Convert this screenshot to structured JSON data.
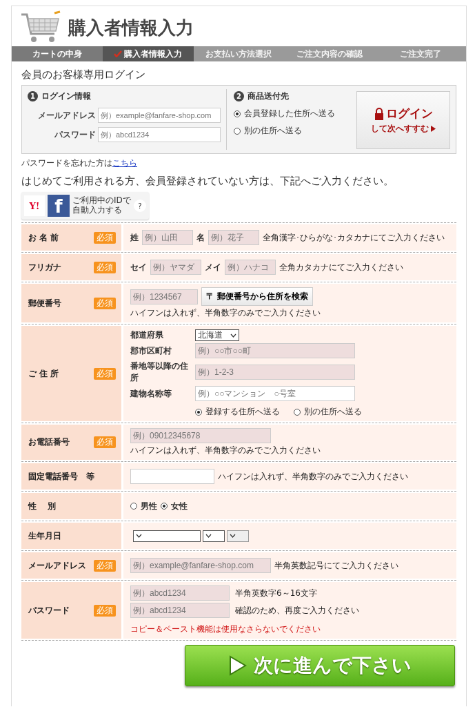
{
  "header": {
    "title": "購入者情報入力"
  },
  "steps": [
    {
      "label": "カートの中身",
      "selected": false,
      "completed": true
    },
    {
      "label": "購入者情報入力",
      "selected": true,
      "completed": false
    },
    {
      "label": "お支払い方法選択",
      "selected": false,
      "completed": false
    },
    {
      "label": "ご注文内容の確認",
      "selected": false,
      "completed": false
    },
    {
      "label": "ご注文完了",
      "selected": false,
      "completed": false
    }
  ],
  "login": {
    "heading": "会員のお客様専用ログイン",
    "info": {
      "number": "1",
      "title": "ログイン情報",
      "fields": [
        {
          "label": "メールアドレス",
          "placeholder": "例）example@fanfare-shop.com"
        },
        {
          "label": "パスワード",
          "placeholder": "例）abcd1234"
        }
      ]
    },
    "shipping": {
      "number": "2",
      "title": "商品送付先",
      "options": [
        {
          "label": "会員登録した住所へ送る",
          "selected": true
        },
        {
          "label": "別の住所へ送る",
          "selected": false
        }
      ]
    },
    "button": {
      "label": "ログイン",
      "sublabel": "して次へすすむ"
    }
  },
  "forgot": {
    "text": "パスワードを忘れた方は",
    "link": "こちら"
  },
  "guest_heading": "はじめてご利用される方、会員登録されていない方は、下記へご入力ください。",
  "social": {
    "yahoo": "Y!",
    "facebook": "f",
    "lines": [
      "ご利用中のIDで",
      "自動入力する"
    ],
    "help": "?"
  },
  "rows": [
    {
      "kind": "pair",
      "label": "お 名 前",
      "badge": "必須",
      "fields": [
        {
          "label": "姓",
          "placeholder": "例）山田"
        },
        {
          "label": "名",
          "placeholder": "例）花子"
        }
      ],
      "note": "全角漢字･ひらがな･カタカナにてご入力ください"
    },
    {
      "kind": "pair",
      "label": "フリガナ",
      "badge": "必須",
      "fields": [
        {
          "label": "セイ",
          "placeholder": "例）ヤマダ"
        },
        {
          "label": "メイ",
          "placeholder": "例）ハナコ"
        }
      ],
      "note": "全角カタカナにてご入力ください"
    },
    {
      "kind": "postal",
      "label": "郵便番号",
      "badge": "必須",
      "placeholder": "例）1234567",
      "button": "〒 郵便番号から住所を検索",
      "note": "ハイフンは入れず、半角数字のみでご入力ください"
    },
    {
      "kind": "address",
      "label": "ご 住 所",
      "badge": "必須",
      "prefecture": {
        "label": "都道府県",
        "value": "北海道"
      },
      "fields": [
        {
          "label": "郡市区町村",
          "placeholder": "例）○○市○○町",
          "highlighted": true
        },
        {
          "label": "番地等以降の住所",
          "placeholder": "例）1-2-3",
          "highlighted": true
        },
        {
          "label": "建物名称等",
          "placeholder": "例）○○マンション　○号室",
          "highlighted": false
        }
      ],
      "options": [
        {
          "label": "登録する住所へ送る",
          "selected": true
        },
        {
          "label": "別の住所へ送る",
          "selected": false
        }
      ]
    },
    {
      "kind": "single",
      "label": "お電話番号",
      "badge": "必須",
      "placeholder": "例）09012345678",
      "highlighted": true,
      "note": "ハイフンは入れず、半角数字のみでご入力ください"
    },
    {
      "kind": "single",
      "label": "固定電話番号　等",
      "highlighted": false,
      "note": "ハイフンは入れず、半角数字のみでご入力ください"
    },
    {
      "kind": "radio",
      "label": "性　 別",
      "options": [
        {
          "label": "男性",
          "selected": false
        },
        {
          "label": "女性",
          "selected": true
        }
      ]
    },
    {
      "kind": "date",
      "label": "生年月日",
      "selects": [
        {
          "disabled": false
        },
        {
          "disabled": false
        },
        {
          "disabled": true
        }
      ]
    },
    {
      "kind": "single",
      "label": "メールアドレス",
      "badge": "必須",
      "placeholder": "例）example@fanfare-shop.com",
      "highlighted": true,
      "note": "半角英数記号にてご入力ください"
    },
    {
      "kind": "password",
      "label": "パスワード",
      "badge": "必須",
      "fields": [
        {
          "placeholder": "例）abcd1234",
          "note": "半角英数字6～16文字"
        },
        {
          "placeholder": "例）abcd1234",
          "note": "確認のため、再度ご入力ください",
          "warning": "コピー＆ペースト機能は使用なさらないでください"
        }
      ]
    }
  ],
  "submit": {
    "label": "次に進んで下さい"
  }
}
